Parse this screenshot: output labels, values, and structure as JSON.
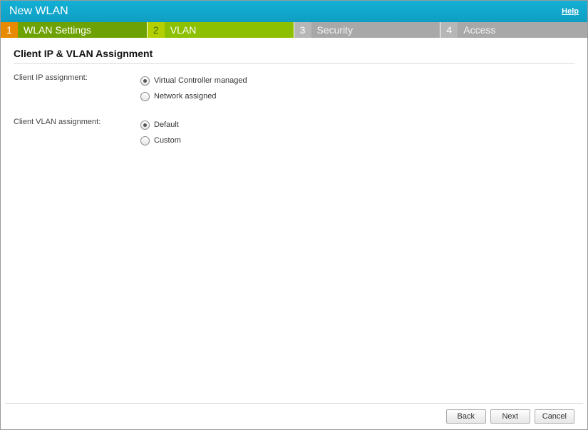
{
  "window": {
    "title": "New WLAN",
    "help_label": "Help"
  },
  "steps": [
    {
      "num": "1",
      "label": "WLAN Settings",
      "state": "completed"
    },
    {
      "num": "2",
      "label": "VLAN",
      "state": "current"
    },
    {
      "num": "3",
      "label": "Security",
      "state": "upcoming"
    },
    {
      "num": "4",
      "label": "Access",
      "state": "upcoming"
    }
  ],
  "section": {
    "title": "Client IP & VLAN Assignment"
  },
  "form": {
    "ip_label": "Client IP assignment:",
    "ip_options": [
      {
        "label": "Virtual Controller managed",
        "selected": true
      },
      {
        "label": "Network assigned",
        "selected": false
      }
    ],
    "vlan_label": "Client VLAN assignment:",
    "vlan_options": [
      {
        "label": "Default",
        "selected": true
      },
      {
        "label": "Custom",
        "selected": false
      }
    ]
  },
  "buttons": {
    "back": "Back",
    "next": "Next",
    "cancel": "Cancel"
  }
}
